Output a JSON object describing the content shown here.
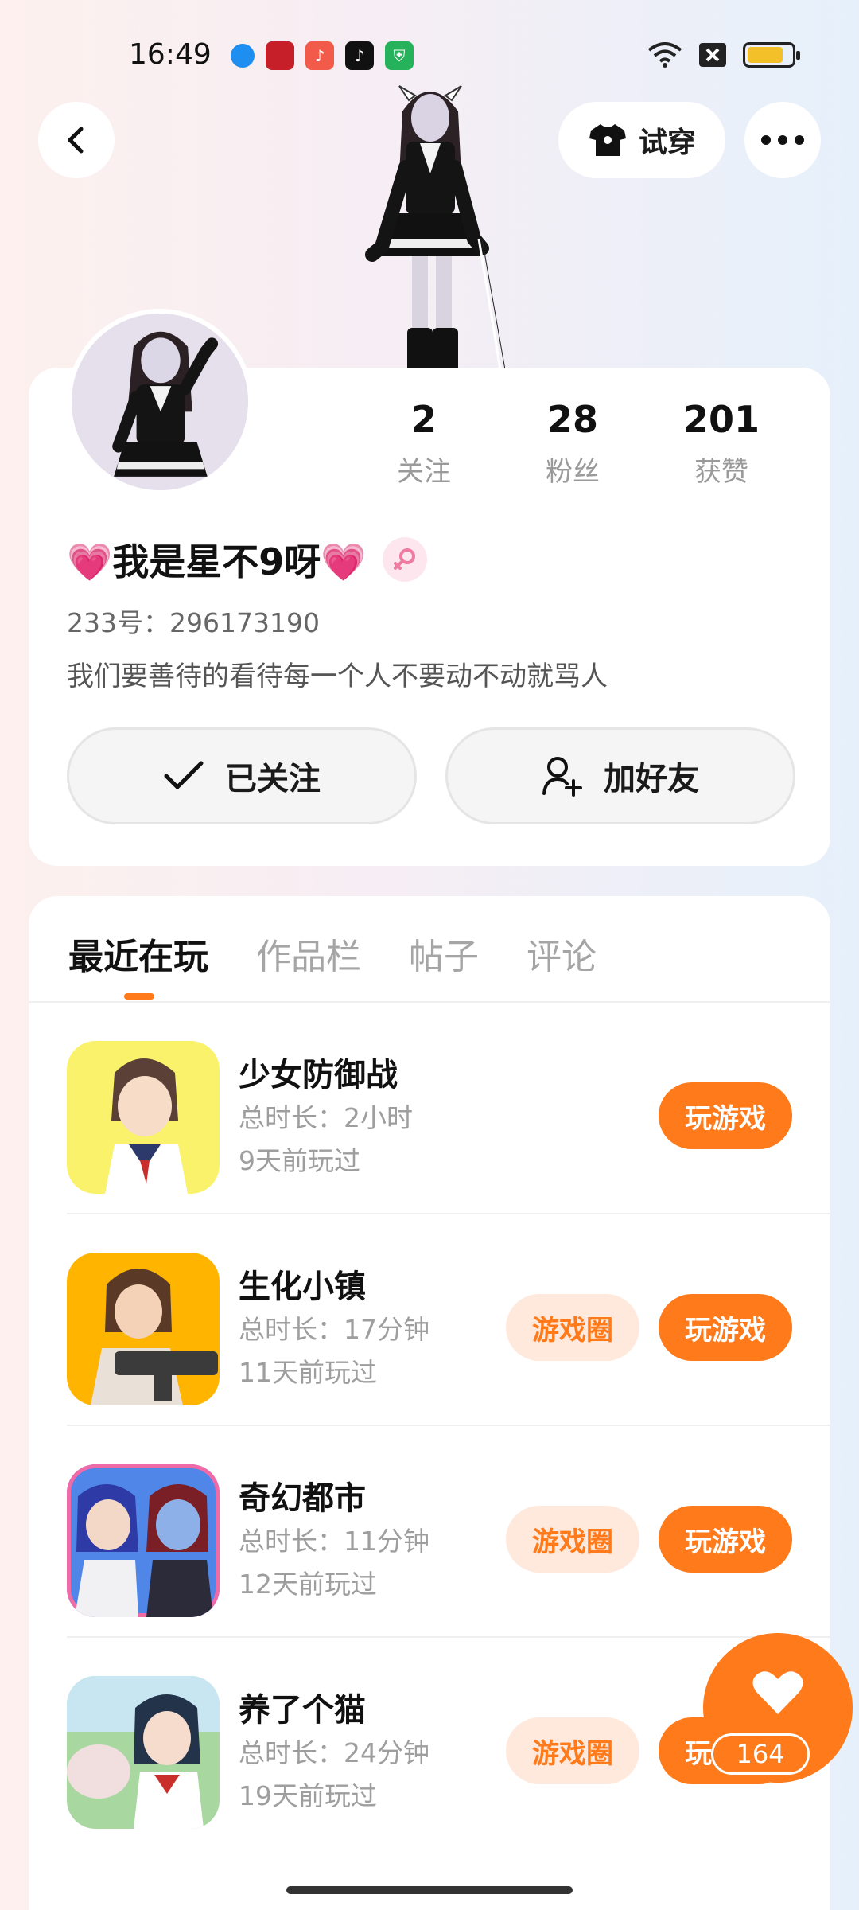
{
  "status_bar": {
    "time": "16:49"
  },
  "header": {
    "tryon_label": "试穿"
  },
  "profile": {
    "stats": [
      {
        "value": "2",
        "label": "关注"
      },
      {
        "value": "28",
        "label": "粉丝"
      },
      {
        "value": "201",
        "label": "获赞"
      }
    ],
    "nickname": "💗我是星不9呀💗",
    "user_id": "233号：296173190",
    "bio": "我们要善待的看待每一个人不要动不动就骂人",
    "followed_label": "已关注",
    "add_friend_label": "加好友"
  },
  "tabs": [
    {
      "label": "最近在玩",
      "active": true
    },
    {
      "label": "作品栏",
      "active": false
    },
    {
      "label": "帖子",
      "active": false
    },
    {
      "label": "评论",
      "active": false
    }
  ],
  "games": [
    {
      "name": "少女防御战",
      "duration": "总时长：2小时",
      "last_played": "9天前玩过",
      "circle_label": "",
      "play_label": "玩游戏"
    },
    {
      "name": "生化小镇",
      "duration": "总时长：17分钟",
      "last_played": "11天前玩过",
      "circle_label": "游戏圈",
      "play_label": "玩游戏"
    },
    {
      "name": "奇幻都市",
      "duration": "总时长：11分钟",
      "last_played": "12天前玩过",
      "circle_label": "游戏圈",
      "play_label": "玩游戏"
    },
    {
      "name": "养了个猫",
      "duration": "总时长：24分钟",
      "last_played": "19天前玩过",
      "circle_label": "游戏圈",
      "play_label": "玩游戏"
    }
  ],
  "like": {
    "count": "164"
  },
  "colors": {
    "accent": "#ff7a1a",
    "accent_soft": "#ffe9dc"
  }
}
